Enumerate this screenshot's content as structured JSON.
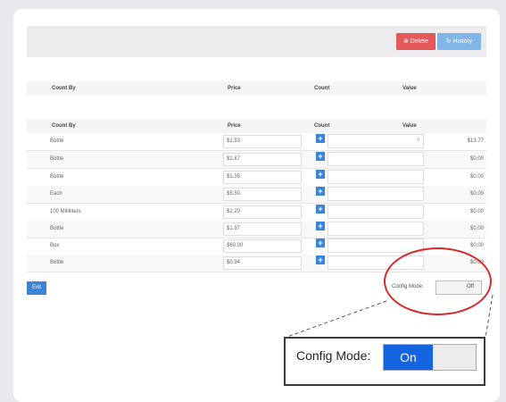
{
  "toolbar": {
    "delete_label": "Delete",
    "history_label": "History"
  },
  "summary_table": {
    "headers": [
      "Count By",
      "Price",
      "Count",
      "Value"
    ]
  },
  "items_table": {
    "headers": [
      "Count By",
      "Price",
      "Count",
      "Value"
    ],
    "rows": [
      {
        "count_by": "Bottle",
        "price": "$1.53",
        "count": "9",
        "value": "$13.77"
      },
      {
        "count_by": "Bottle",
        "price": "$1.87",
        "count": "",
        "value": "$0.00"
      },
      {
        "count_by": "Bottle",
        "price": "$1.35",
        "count": "",
        "value": "$0.00"
      },
      {
        "count_by": "Each",
        "price": "$5.50",
        "count": "",
        "value": "$0.00"
      },
      {
        "count_by": "100 Milliliters",
        "price": "$2.20",
        "count": "",
        "value": "$0.00"
      },
      {
        "count_by": "Bottle",
        "price": "$1.87",
        "count": "",
        "value": "$0.00"
      },
      {
        "count_by": "Box",
        "price": "$60.00",
        "count": "",
        "value": "$0.00"
      },
      {
        "count_by": "Bottle",
        "price": "$0.94",
        "count": "",
        "value": "$0.00"
      }
    ]
  },
  "footer": {
    "exit_label": "Exit",
    "config_label": "Config Mode:",
    "config_value": "Off"
  },
  "callout": {
    "label": "Config Mode:",
    "value": "On"
  },
  "colors": {
    "delete": "#e35a58",
    "history": "#81b6e6",
    "primary": "#3a85d6",
    "highlight": "#d42a2a",
    "toggle_on": "#1565e0"
  }
}
